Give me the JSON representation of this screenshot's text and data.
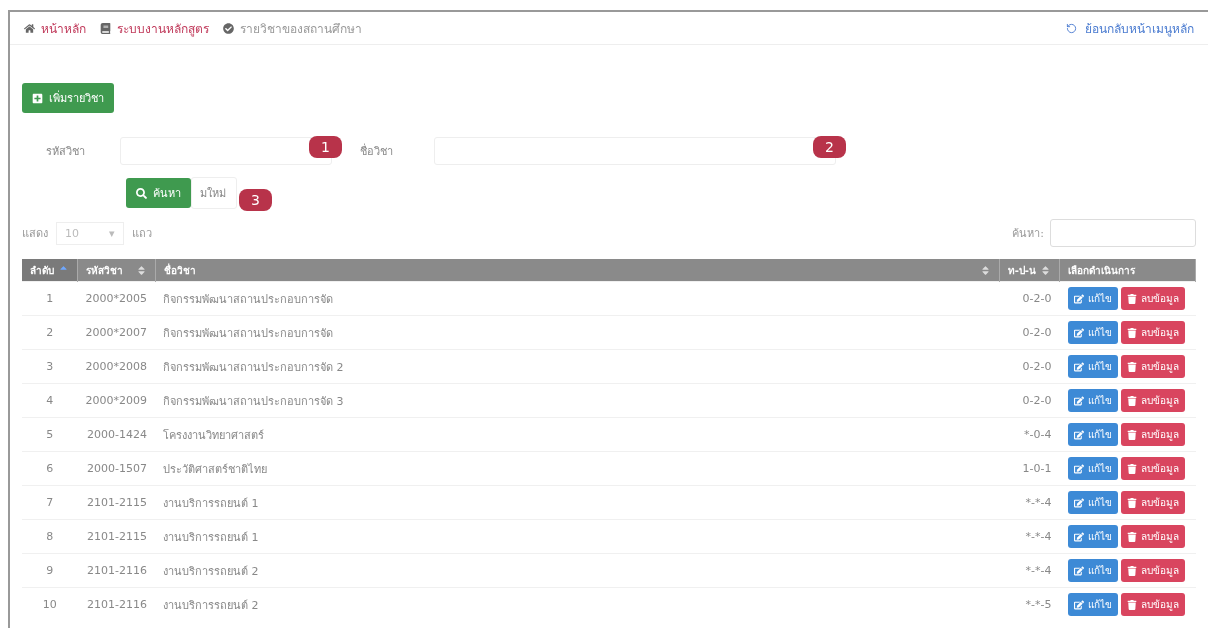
{
  "breadcrumb": [
    {
      "kind": "home",
      "label": "หน้าหลัก",
      "link": true
    },
    {
      "kind": "book",
      "label": "ระบบงานหลักสูตร",
      "link": true
    },
    {
      "kind": "check",
      "label": "รายวิชาของสถานศึกษา",
      "link": false
    }
  ],
  "back_link": "ย้อนกลับหน้าเมนูหลัก",
  "add_button": "เพิ่มรายวิชา",
  "filters": [
    {
      "label": "รหัสวิชา",
      "badge": "1"
    },
    {
      "label": "ชื่อวิชา",
      "badge": "2"
    }
  ],
  "search_button": "ค้นหา",
  "search_badge": "3",
  "reset_button": "มใหม่",
  "length": {
    "prefix": "แสดง",
    "value": "10",
    "caret": "▾",
    "suffix": "แถว"
  },
  "table_search_label": "ค้นหา:",
  "table": {
    "columns": [
      {
        "label": "ลำดับ",
        "sortable": true,
        "sorted": true
      },
      {
        "label": "รหัสวิชา",
        "sortable": true,
        "sorted": false
      },
      {
        "label": "ชื่อวิชา",
        "sortable": true,
        "sorted": false
      },
      {
        "label": "ท-ป-น",
        "sortable": true,
        "sorted": false
      },
      {
        "label": "เลือกดำเนินการ"
      }
    ],
    "rows": [
      {
        "no": "1",
        "code": "2000*2005",
        "name": "กิจกรรมพัฒนาสถานประกอบการจัด",
        "credits": "0-2-0",
        "edit": "แก้ไข",
        "delete": "ลบข้อมูล"
      },
      {
        "no": "2",
        "code": "2000*2007",
        "name": "กิจกรรมพัฒนาสถานประกอบการจัด",
        "credits": "0-2-0",
        "edit": "แก้ไข",
        "delete": "ลบข้อมูล"
      },
      {
        "no": "3",
        "code": "2000*2008",
        "name": "กิจกรรมพัฒนาสถานประกอบการจัด 2",
        "credits": "0-2-0",
        "edit": "แก้ไข",
        "delete": "ลบข้อมูล"
      },
      {
        "no": "4",
        "code": "2000*2009",
        "name": "กิจกรรมพัฒนาสถานประกอบการจัด 3",
        "credits": "0-2-0",
        "edit": "แก้ไข",
        "delete": "ลบข้อมูล"
      },
      {
        "no": "5",
        "code": "2000-1424",
        "name": "โครงงานวิทยาศาสตร์",
        "credits": "*-0-4",
        "edit": "แก้ไข",
        "delete": "ลบข้อมูล"
      },
      {
        "no": "6",
        "code": "2000-1507",
        "name": "ประวัติศาสตร์ชาติไทย",
        "credits": "1-0-1",
        "edit": "แก้ไข",
        "delete": "ลบข้อมูล"
      },
      {
        "no": "7",
        "code": "2101-2115",
        "name": "งานบริการรถยนต์ 1",
        "credits": "*-*-4",
        "edit": "แก้ไข",
        "delete": "ลบข้อมูล"
      },
      {
        "no": "8",
        "code": "2101-2115",
        "name": "งานบริการรถยนต์ 1",
        "credits": "*-*-4",
        "edit": "แก้ไข",
        "delete": "ลบข้อมูล"
      },
      {
        "no": "9",
        "code": "2101-2116",
        "name": "งานบริการรถยนต์ 2",
        "credits": "*-*-4",
        "edit": "แก้ไข",
        "delete": "ลบข้อมูล"
      },
      {
        "no": "10",
        "code": "2101-2116",
        "name": "งานบริการรถยนต์ 2",
        "credits": "*-*-5",
        "edit": "แก้ไข",
        "delete": "ลบข้อมูล"
      }
    ]
  }
}
